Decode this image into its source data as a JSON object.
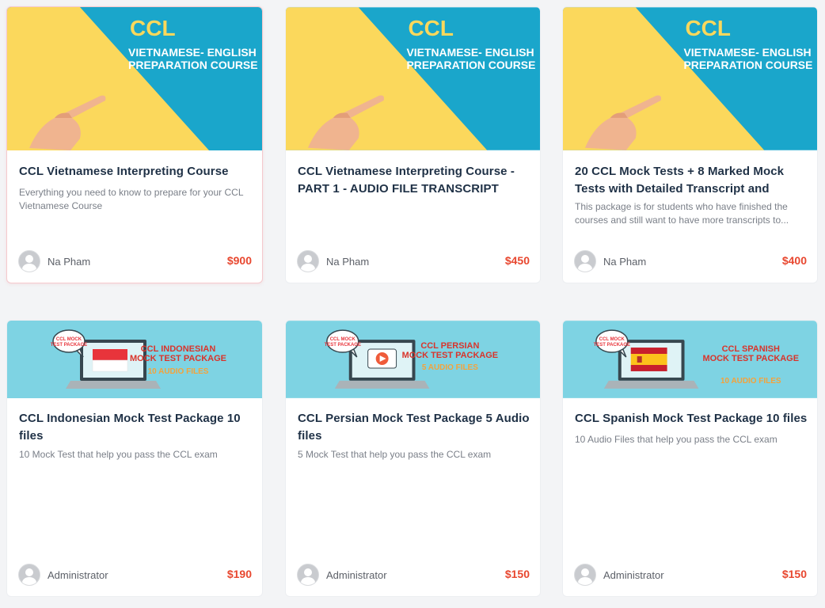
{
  "banner_vn": {
    "line1": "CCL",
    "line2": "VIETNAMESE- ENGLISH",
    "line3": "PREPARATION COURSE"
  },
  "banner_mock": {
    "bubble1": "CCL MOCK",
    "bubble2": "TEST PACKAGE"
  },
  "colors": {
    "accent_price": "#e8472f",
    "title": "#1f3146",
    "banner_blue": "#1aa6cb",
    "banner_yellow": "#fbd85c",
    "banner_mock_bg": "#7ed3e3"
  },
  "courses": [
    {
      "title": "CCL Vietnamese Interpreting Course",
      "description": "Everything you need to know to prepare for your CCL Vietnamese Course",
      "author": "Na Pham",
      "price": "$900",
      "banner_icon": "pointing-hand-icon"
    },
    {
      "title": "CCL Vietnamese Interpreting Course - PART 1 - AUDIO FILE TRANSCRIPT",
      "description": "",
      "author": "Na Pham",
      "price": "$450",
      "banner_icon": "pointing-hand-icon"
    },
    {
      "title": "20 CCL Mock Tests + 8 Marked Mock Tests with Detailed Transcript and",
      "description": "This package is for students who have finished the courses and still want to have more transcripts to...",
      "author": "Na Pham",
      "price": "$400",
      "banner_icon": "pointing-hand-icon"
    },
    {
      "title": "CCL Indonesian Mock Test Package 10 files",
      "description": "10 Mock Test that help you pass the CCL exam",
      "author": "Administrator",
      "price": "$190",
      "banner_l1": "CCL INDONESIAN",
      "banner_l2": "MOCK TEST PACKAGE",
      "banner_l3": "10 AUDIO FILES",
      "banner_icon": "indonesia-flag-icon"
    },
    {
      "title": "CCL Persian Mock Test Package 5 Audio files",
      "description": "5 Mock Test that help you pass the CCL exam",
      "author": "Administrator",
      "price": "$150",
      "banner_l1": "CCL PERSIAN",
      "banner_l2": "MOCK TEST PACKAGE",
      "banner_l3": "5 AUDIO FILES",
      "banner_icon": "play-icon"
    },
    {
      "title": "CCL Spanish Mock Test Package 10 files",
      "description": "10 Audio Files that help you pass the CCL exam",
      "author": "Administrator",
      "price": "$150",
      "banner_l1": "CCL SPANISH",
      "banner_l2": "MOCK TEST PACKAGE",
      "banner_l3": "10 AUDIO FILES",
      "banner_icon": "spain-flag-icon"
    }
  ]
}
